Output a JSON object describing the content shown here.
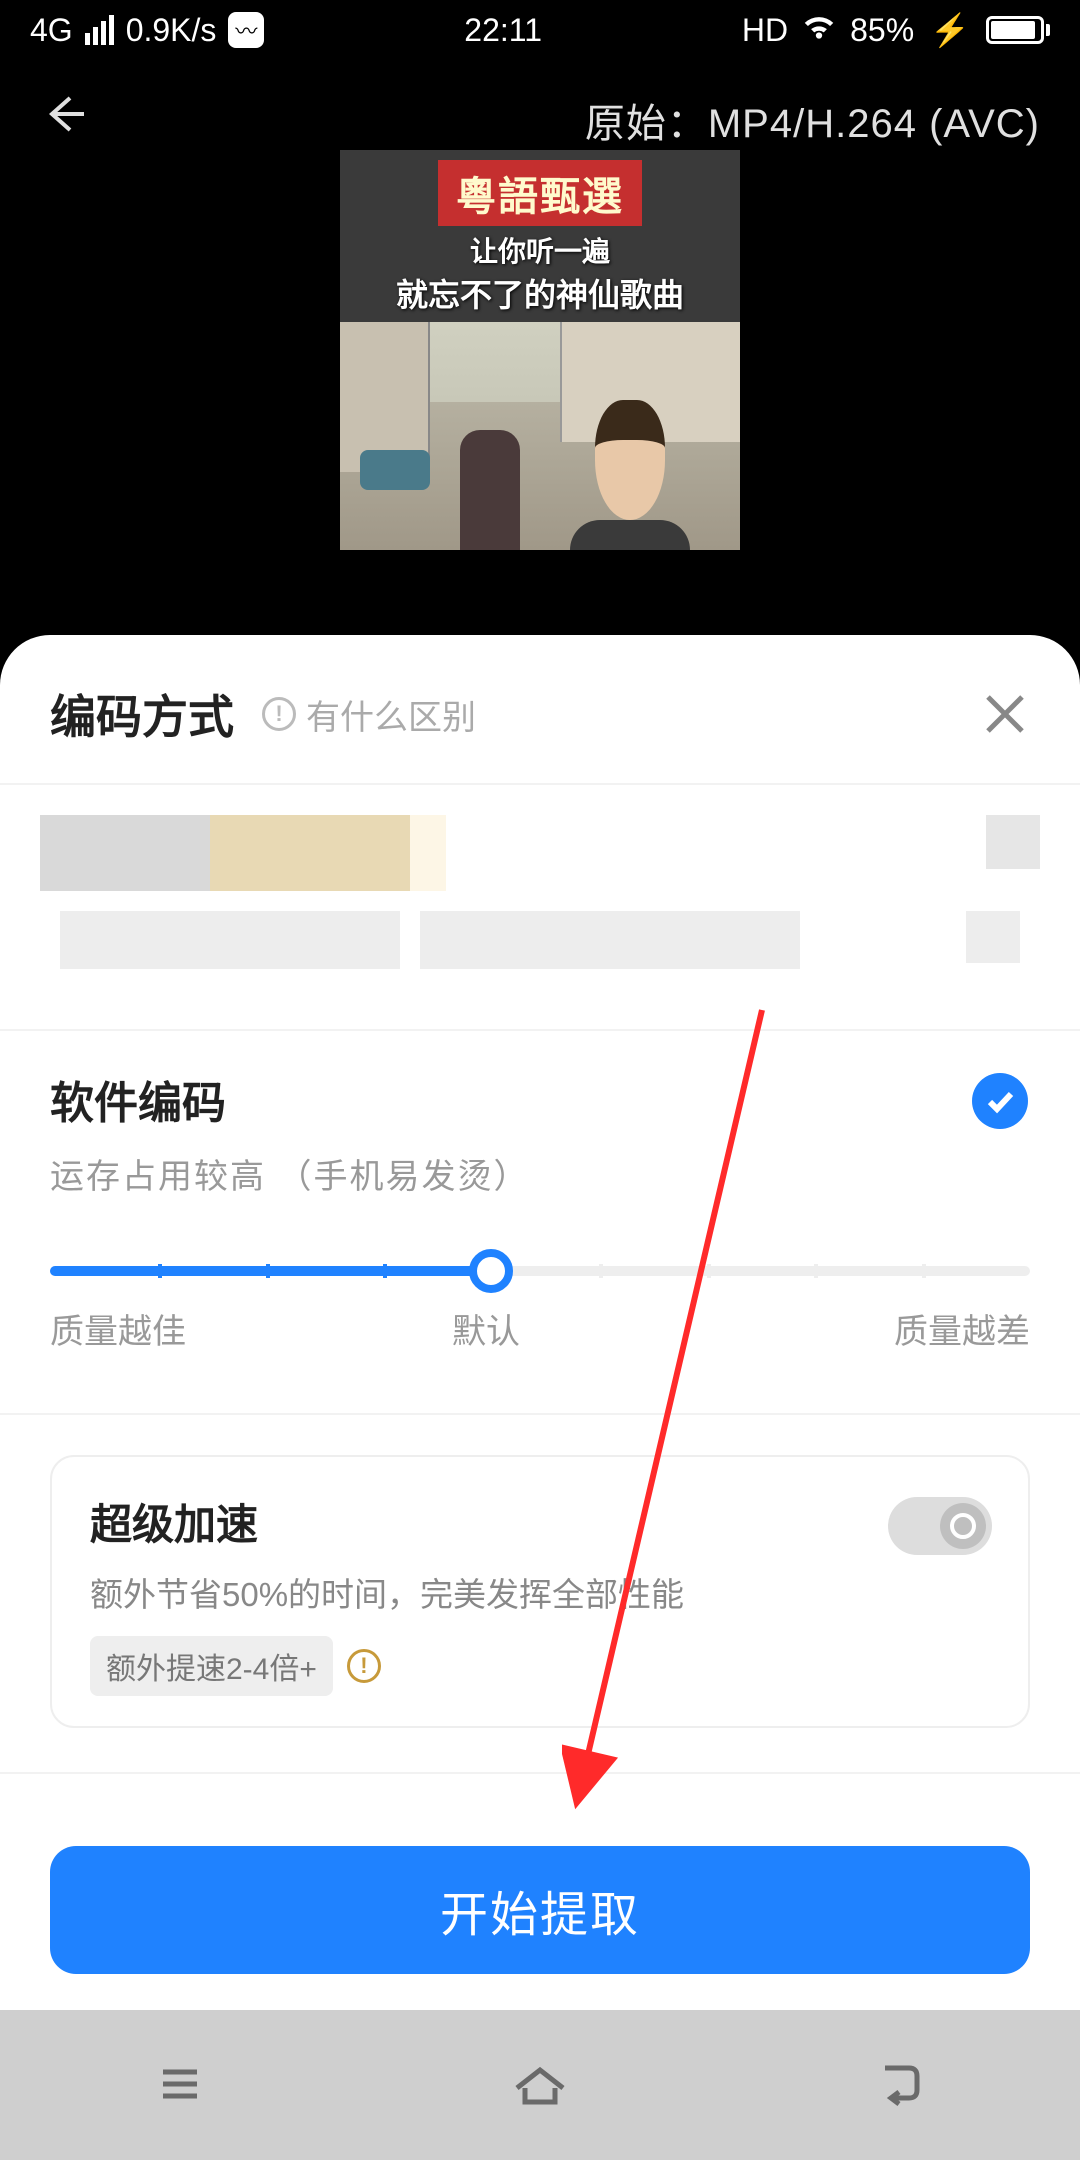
{
  "status": {
    "network": "4G",
    "speed": "0.9K/s",
    "time": "22:11",
    "hd": "HD",
    "battery_pct": "85%"
  },
  "topbar": {
    "format_label": "原始：",
    "format_value": "MP4/H.264 (AVC)"
  },
  "preview": {
    "banner": "粵語甄選",
    "line1": "让你听一遍",
    "line2": "就忘不了的神仙歌曲"
  },
  "sheet": {
    "title": "编码方式",
    "help": "有什么区别"
  },
  "option": {
    "title": "软件编码",
    "desc": "运存占用较高 （手机易发烫）"
  },
  "slider": {
    "left": "质量越佳",
    "mid": "默认",
    "right": "质量越差"
  },
  "accel": {
    "title": "超级加速",
    "desc": "额外节省50%的时间，完美发挥全部性能",
    "badge": "额外提速2-4倍+"
  },
  "primary": {
    "label": "开始提取"
  }
}
